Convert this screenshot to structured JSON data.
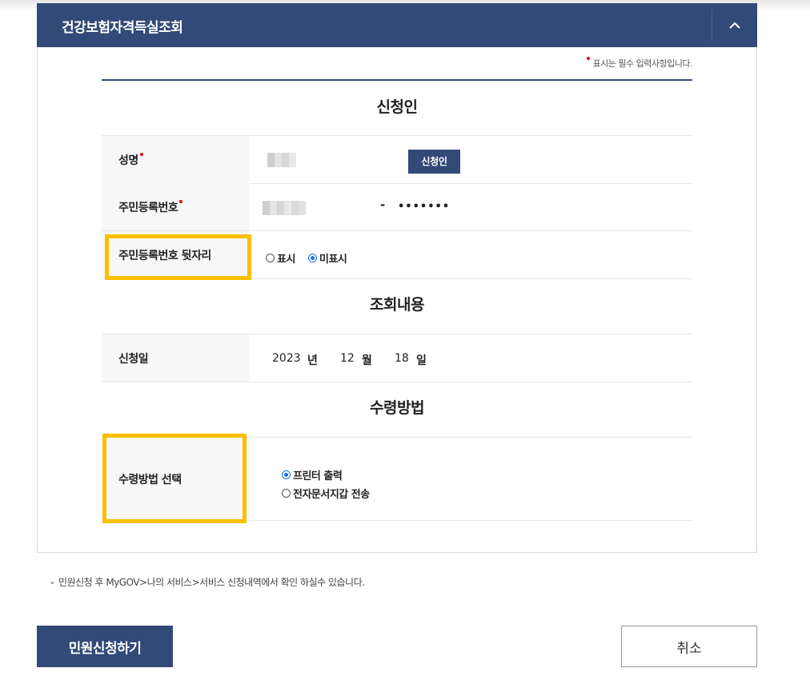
{
  "panel": {
    "title": "건강보험자격득실조회",
    "required_note": "표시는 필수 입력사항입니다."
  },
  "sections": {
    "applicant": "신청인",
    "inquiry": "조회내용",
    "receive": "수령방법"
  },
  "fields": {
    "name_label": "성명",
    "applicant_button": "신청인",
    "rrn_label": "주민등록번호",
    "rrn_dash": "-",
    "rrn_masked": "•••••••",
    "rrn_back_label": "주민등록번호 뒷자리",
    "rrn_back_options": [
      "표시",
      "미표시"
    ],
    "rrn_back_selected": "미표시",
    "date_label": "신청일",
    "date": {
      "year": "2023",
      "year_unit": "년",
      "month": "12",
      "month_unit": "월",
      "day": "18",
      "day_unit": "일"
    },
    "receive_label": "수령방법 선택",
    "receive_options": [
      "프린터 출력",
      "전자문서지갑 전송"
    ],
    "receive_selected": "프린터 출력"
  },
  "notice": "민원신청 후 MyGOV>나의 서비스>서비스 신청내역에서 확인 하실수 있습니다.",
  "buttons": {
    "submit": "민원신청하기",
    "cancel": "취소"
  },
  "colors": {
    "primary": "#324a77",
    "required": "#e60012",
    "highlight": "#fbbf00",
    "radio_selected": "#1a73e8"
  }
}
